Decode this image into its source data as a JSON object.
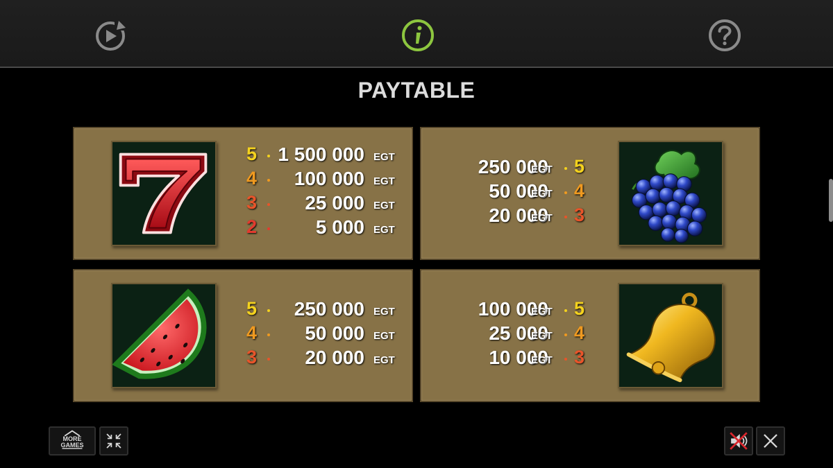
{
  "title": "PAYTABLE",
  "currency": "EGT",
  "colors": {
    "panel": "#877247",
    "count_5": "#f4d21e",
    "count_4": "#f09a20",
    "count_3": "#e8542a",
    "count_2": "#e33a2e",
    "info_accent": "#8dc63f"
  },
  "top_bar": {
    "icons": [
      "replay-icon",
      "info-icon",
      "help-icon"
    ]
  },
  "paytable": [
    {
      "symbol": "seven",
      "pays": [
        {
          "count": "5",
          "amount": "1 500 000"
        },
        {
          "count": "4",
          "amount": "100 000"
        },
        {
          "count": "3",
          "amount": "25 000"
        },
        {
          "count": "2",
          "amount": "5 000"
        }
      ]
    },
    {
      "symbol": "grapes",
      "pays": [
        {
          "count": "5",
          "amount": "250 000"
        },
        {
          "count": "4",
          "amount": "50 000"
        },
        {
          "count": "3",
          "amount": "20 000"
        }
      ]
    },
    {
      "symbol": "watermelon",
      "pays": [
        {
          "count": "5",
          "amount": "250 000"
        },
        {
          "count": "4",
          "amount": "50 000"
        },
        {
          "count": "3",
          "amount": "20 000"
        }
      ]
    },
    {
      "symbol": "bell",
      "pays": [
        {
          "count": "5",
          "amount": "100 000"
        },
        {
          "count": "4",
          "amount": "25 000"
        },
        {
          "count": "3",
          "amount": "10 000"
        }
      ]
    }
  ],
  "bottom_bar": {
    "more_games_line1": "MORE",
    "more_games_line2": "GAMES",
    "icons": [
      "collapse-icon",
      "sound-muted-icon",
      "close-icon"
    ]
  }
}
